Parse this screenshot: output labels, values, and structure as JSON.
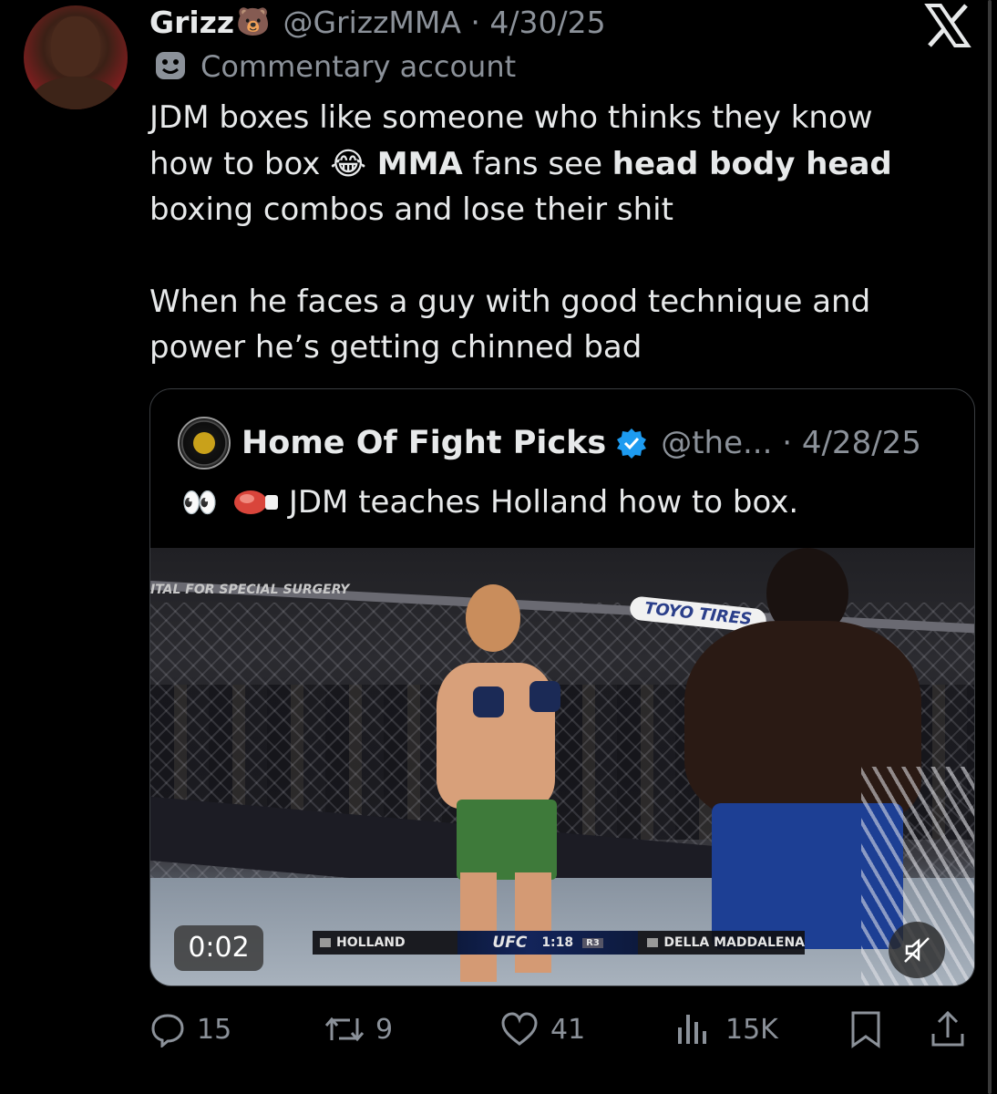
{
  "tweet": {
    "author_name": "Grizz",
    "author_emoji": "🐻",
    "handle_date": "@GrizzMMA · 4/30/25",
    "badge_label": "Commentary account",
    "text_line1": "JDM boxes like someone who thinks they know",
    "text_line2_a": "how to box ",
    "text_line2_emoji": "😂",
    "text_line2_b": " MMA",
    "text_line2_c": " fans see ",
    "text_line2_d": "head body head",
    "text_line3": "boxing combos and lose their shit",
    "text_line4": "When he faces a guy with good technique and",
    "text_line5": "power he’s getting chinned bad"
  },
  "quote": {
    "author_name": "Home Of Fight Picks",
    "handle_date": "@the... · 4/28/25",
    "eyes_emoji": "👀",
    "text": "JDM teaches Holland how to box.",
    "video": {
      "timestamp": "0:02",
      "banner_text": "ITAL FOR SPECIAL SURGERY",
      "sponsor_text": "TOYO TIRES",
      "score_red": "HOLLAND",
      "score_logo": "UFC",
      "score_clock": "1:18",
      "score_round": "R3",
      "score_blue": "DELLA MADDALENA"
    }
  },
  "actions": {
    "replies": "15",
    "reposts": "9",
    "likes": "41",
    "views": "15K"
  },
  "icons": [
    "x-logo-icon",
    "mask-icon",
    "verified-icon",
    "boxing-glove-icon",
    "reply-icon",
    "repost-icon",
    "like-icon",
    "views-icon",
    "bookmark-icon",
    "share-icon",
    "mute-icon"
  ],
  "colors": {
    "background": "#000000",
    "text": "#e7e9ea",
    "muted": "#8b9199",
    "verified": "#1d9bf0",
    "border": "#3a3d41"
  }
}
